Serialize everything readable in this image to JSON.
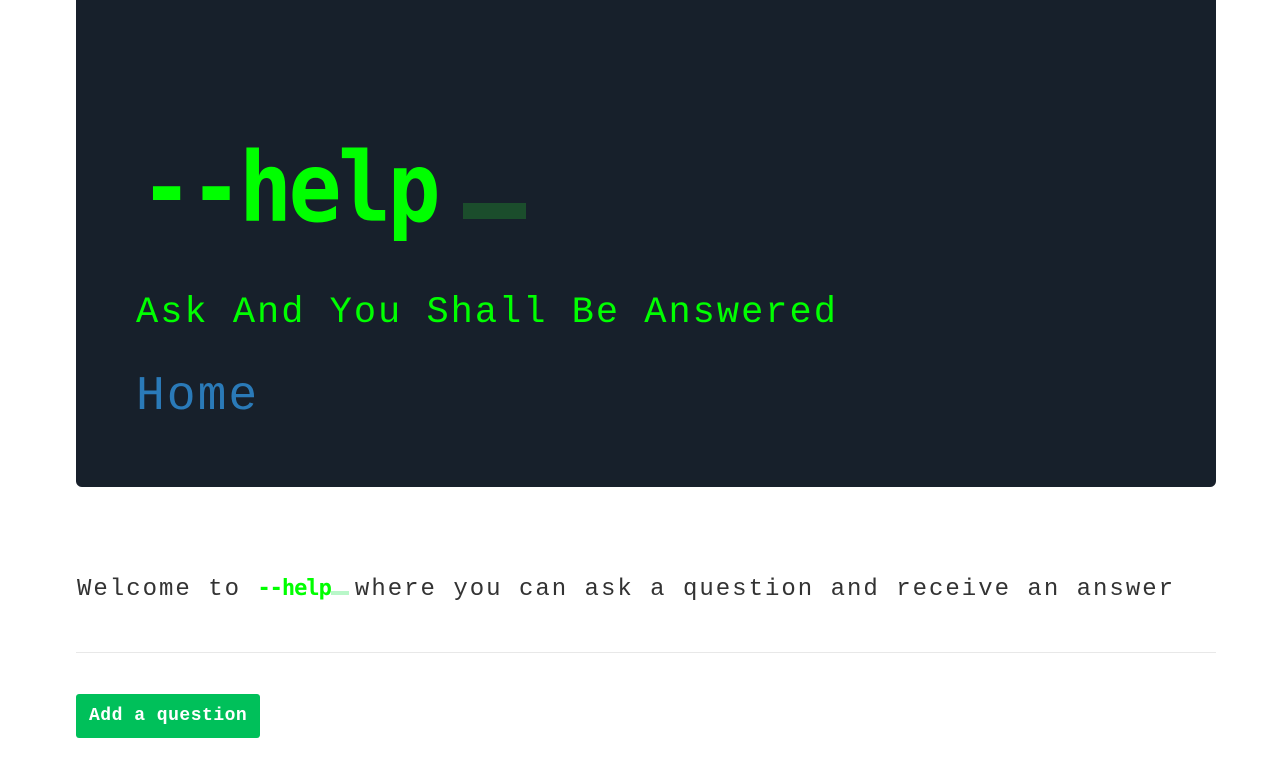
{
  "hero": {
    "logo_text": "--help",
    "tagline": "Ask And You Shall Be Answered",
    "home_link": "Home"
  },
  "welcome": {
    "prefix": "Welcome to",
    "brand": "--help",
    "suffix": "where you can ask a question and receive an answer"
  },
  "actions": {
    "add_question_label": "Add a question"
  },
  "colors": {
    "hero_background": "#17202b",
    "logo_green": "#00ff00",
    "link_blue": "#2a7ab8",
    "button_green": "#00c05a"
  }
}
